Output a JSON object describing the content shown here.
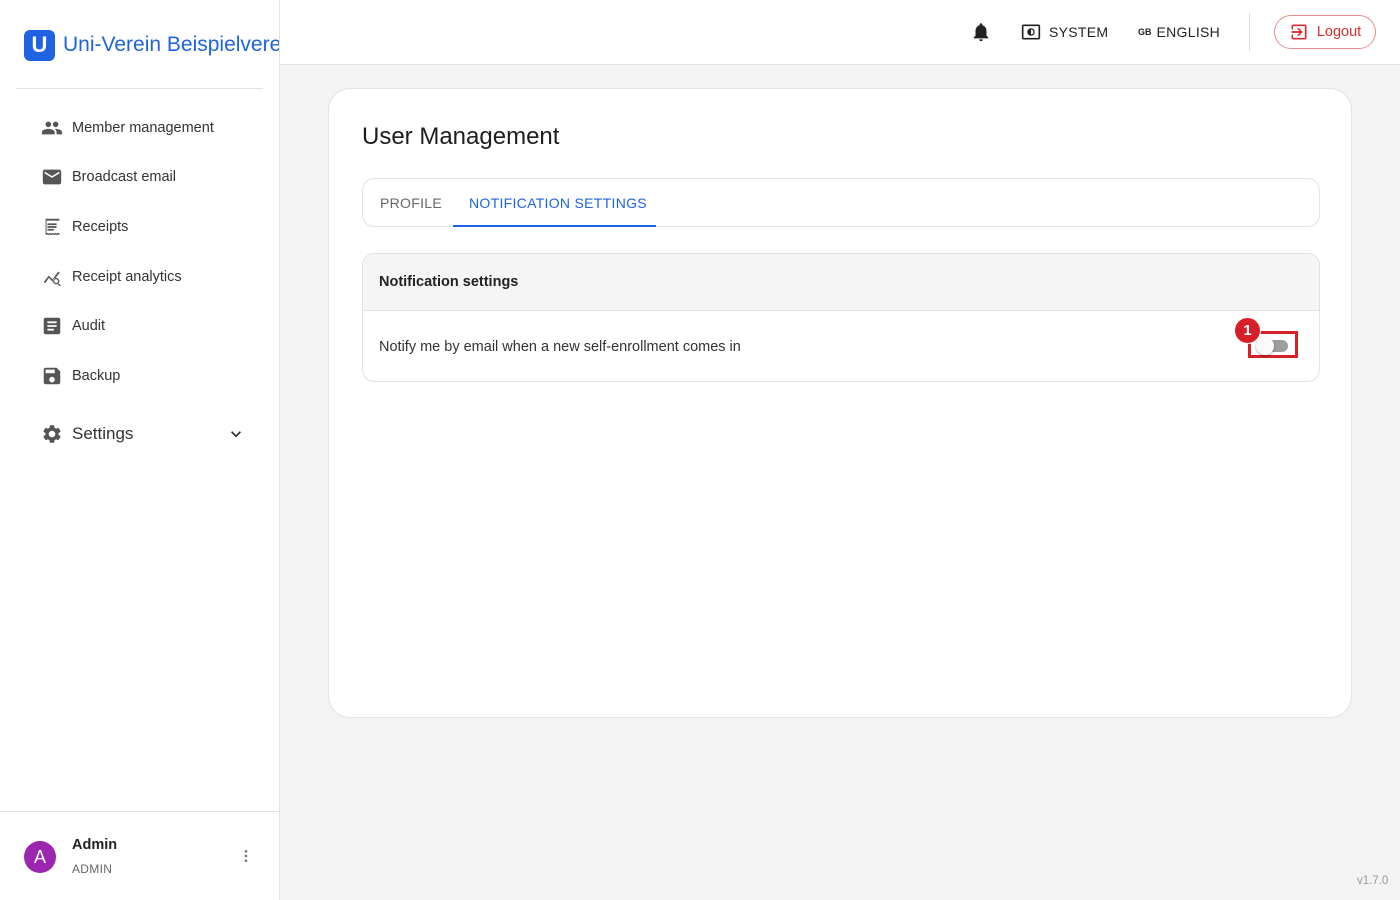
{
  "brand": {
    "logo_letter": "U",
    "name": "Uni-Verein Beispielverein"
  },
  "sidebar": {
    "items": [
      {
        "label": "Member management",
        "icon": "people-icon"
      },
      {
        "label": "Broadcast email",
        "icon": "mail-icon"
      },
      {
        "label": "Receipts",
        "icon": "receipt-icon"
      },
      {
        "label": "Receipt analytics",
        "icon": "analytics-icon"
      },
      {
        "label": "Audit",
        "icon": "document-icon"
      },
      {
        "label": "Backup",
        "icon": "save-icon"
      }
    ],
    "settings": {
      "label": "Settings",
      "icon": "gear-icon",
      "chevron": "chevron-down-icon"
    }
  },
  "user": {
    "avatar_letter": "A",
    "name": "Admin",
    "role": "ADMIN"
  },
  "topbar": {
    "theme_label": "SYSTEM",
    "lang_flag": "GB",
    "lang_label": "ENGLISH",
    "logout_label": "Logout"
  },
  "main": {
    "title": "User Management",
    "tabs": [
      {
        "label": "PROFILE",
        "active": false
      },
      {
        "label": "NOTIFICATION SETTINGS",
        "active": true
      }
    ],
    "panel": {
      "title": "Notification settings",
      "row_label": "Notify me by email when a new self-enrollment comes in",
      "toggle_on": false
    }
  },
  "annotation": {
    "marker": "1",
    "color": "#d61f26"
  },
  "colors": {
    "accent": "#1f63e0",
    "logout": "#d32f2f",
    "avatar": "#9b27b0"
  },
  "version": "v1.7.0"
}
